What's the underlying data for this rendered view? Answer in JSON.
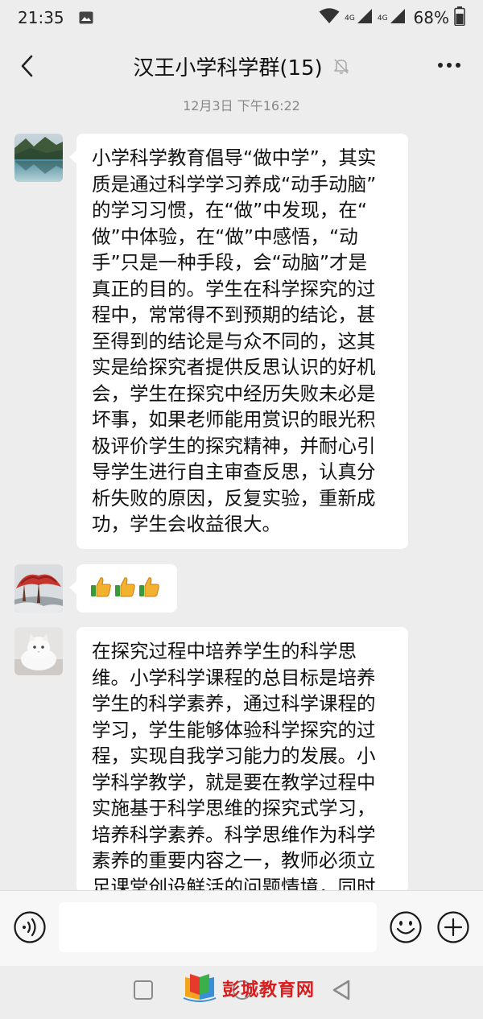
{
  "status_bar": {
    "time": "21:35",
    "network_label_1": "4G",
    "network_label_2": "4G",
    "battery": "68%"
  },
  "header": {
    "title": "汉王小学科学群(15)",
    "back_icon": "chevron-left-icon",
    "mute_icon": "bell-off-icon",
    "more_icon": "more-dots-icon"
  },
  "timestamp": "12月3日 下午16:22",
  "messages": [
    {
      "avatar": "landscape-lake",
      "lines": [
        "小学科学教育倡导“做中学”，其实",
        "质是通过科学学习养成“动手动脑”",
        "的学习习惯，在“做”中发现，在“",
        "做”中体验，在“做”中感悟，“动",
        "手”只是一种手段，会“动脑”才是",
        "真正的目的。学生在科学探究的过",
        "程中，常常得不到预期的结论，甚",
        "至得到的结论是与众不同的，这其",
        "实是给探究者提供反思认识的好机",
        "会，学生在探究中经历失败未必是",
        "坏事，如果老师能用赏识的眼光积",
        "极评价学生的探究精神，并耐心引",
        "导学生进行自主审查反思，认真分",
        "析失败的原因，反复实验，重新成",
        "功，学生会收益很大。"
      ]
    },
    {
      "avatar": "red-tree-painting",
      "emoji": "thumbs-up",
      "emoji_count": 3
    },
    {
      "avatar": "white-cat",
      "lines": [
        "在探究过程中培养学生的科学思",
        "维。小学科学课程的总目标是培养",
        "学生的科学素养，通过科学课程的",
        "学习，学生能够体验科学探究的过",
        "程，实现自我学习能力的发展。小",
        "学科学教学，就是要在教学过程中",
        "实施基于科学思维的探究式学习，",
        "培养科学素养。科学思维作为科学",
        "素养的重要内容之一，教师必须立",
        "足课堂创设鲜活的问题情境，同时"
      ]
    }
  ],
  "input_bar": {
    "voice_icon": "voice-icon",
    "emoji_icon": "smiley-icon",
    "plus_icon": "plus-circle-icon",
    "text_value": ""
  },
  "watermark": "彭城教育网",
  "colors": {
    "background": "#ededed",
    "bubble": "#ffffff",
    "watermark_red": "#d91c1c"
  }
}
